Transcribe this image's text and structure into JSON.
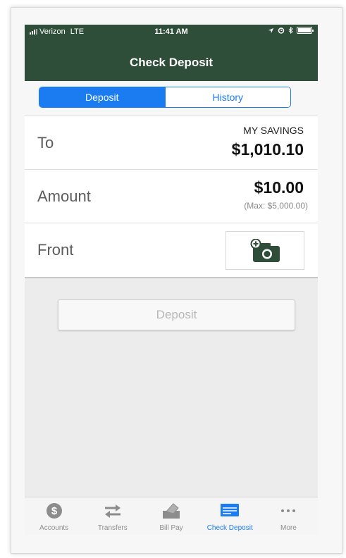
{
  "status": {
    "carrier": "Verizon",
    "network": "LTE",
    "time": "11:41 AM"
  },
  "header": {
    "title": "Check Deposit"
  },
  "segments": {
    "deposit": "Deposit",
    "history": "History"
  },
  "to_row": {
    "label": "To",
    "account": "MY SAVINGS",
    "balance": "$1,010.10"
  },
  "amount_row": {
    "label": "Amount",
    "value": "$10.00",
    "max": "(Max: $5,000.00)"
  },
  "front_row": {
    "label": "Front",
    "icon": "add-camera-icon"
  },
  "deposit_button": {
    "label": "Deposit"
  },
  "tabs": [
    {
      "label": "Accounts",
      "icon": "dollar-icon"
    },
    {
      "label": "Transfers",
      "icon": "transfer-arrows-icon"
    },
    {
      "label": "Bill Pay",
      "icon": "bill-pay-icon"
    },
    {
      "label": "Check Deposit",
      "icon": "check-deposit-icon"
    },
    {
      "label": "More",
      "icon": "more-dots-icon"
    }
  ],
  "colors": {
    "header_bg": "#2e4e3a",
    "accent": "#1b7cf2",
    "body_bg": "#ececec"
  }
}
